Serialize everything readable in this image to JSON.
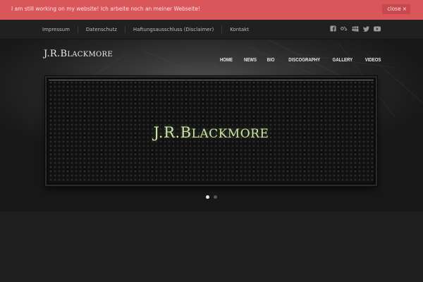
{
  "notice": {
    "text": "I am still working on my website! Ich arbeite noch an meiner Webseite!",
    "close_label": "close",
    "close_icon": "×",
    "bg_color": "#d9565a"
  },
  "topbar": {
    "links": [
      "Impressum",
      "Datenschutz",
      "Haftungsausschluss (Disclaimer)",
      "Kontakt"
    ],
    "social_icons": [
      "facebook-icon",
      "lastfm-icon",
      "myspace-icon",
      "twitter-icon",
      "youtube-icon"
    ]
  },
  "header": {
    "logo_first": "J.R.B",
    "logo_rest": "LACKMORE",
    "nav": [
      "HOME",
      "NEWS",
      "BIO",
      "DISCOGRAPHY",
      "GALLERY",
      "VIDEOS"
    ]
  },
  "slider": {
    "title_first": "J.R.B",
    "title_rest": "LACKMORE",
    "active_slide": 1,
    "slide_count": 2,
    "title_color": "#cfe4a8"
  }
}
